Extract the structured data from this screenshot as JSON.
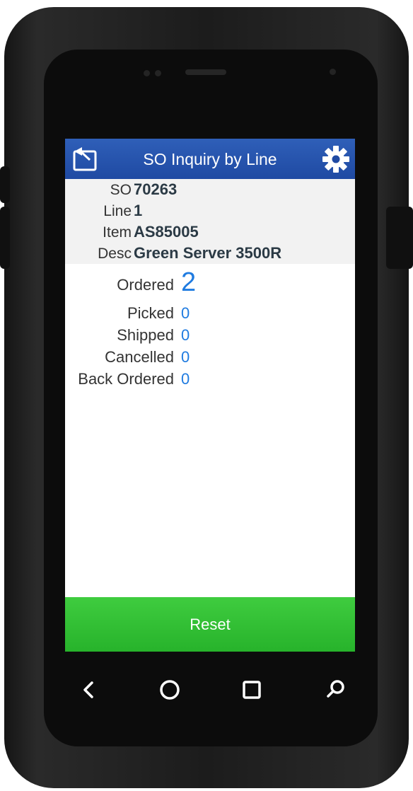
{
  "app": {
    "title": "SO Inquiry by Line",
    "back_icon": "back-arrow-icon",
    "settings_icon": "gear-icon",
    "accent_color": "#1f4aa3"
  },
  "header": {
    "so_label": "SO",
    "so_value": "70263",
    "line_label": "Line",
    "line_value": "1",
    "item_label": "Item",
    "item_value": "AS85005",
    "desc_label": "Desc",
    "desc_value": "Green Server 3500R"
  },
  "quantities": {
    "ordered_label": "Ordered",
    "ordered_value": "2",
    "picked_label": "Picked",
    "picked_value": "0",
    "shipped_label": "Shipped",
    "shipped_value": "0",
    "cancelled_label": "Cancelled",
    "cancelled_value": "0",
    "backordered_label": "Back Ordered",
    "backordered_value": "0",
    "value_color": "#1f7be0"
  },
  "actions": {
    "reset_label": "Reset",
    "reset_color": "#2fbd32"
  },
  "android_nav": {
    "back_icon": "android-back-icon",
    "home_icon": "android-home-icon",
    "recents_icon": "android-recents-icon",
    "search_icon": "search-icon"
  }
}
